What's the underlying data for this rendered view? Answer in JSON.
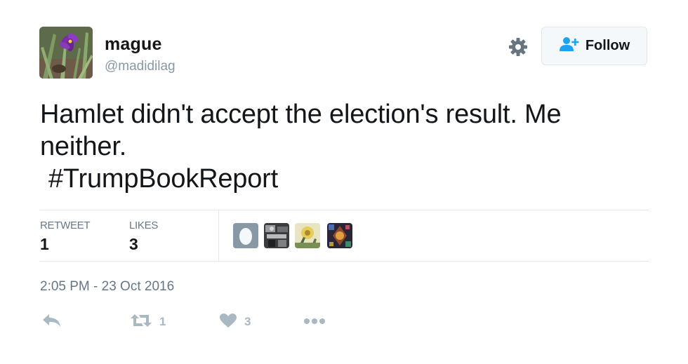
{
  "user": {
    "display_name": "mague",
    "handle": "@madidilag",
    "avatar_icon": "purple-iris-flower-photo"
  },
  "header": {
    "settings_icon": "gear-icon",
    "follow_label": "Follow",
    "follow_icon": "add-user-icon"
  },
  "tweet": {
    "line1": "Hamlet didn't accept the election's result. Me",
    "line2": "neither.",
    "hashtag": "#TrumpBookReport"
  },
  "stats": {
    "retweets_label": "RETWEET",
    "retweets_value": "1",
    "likes_label": "LIKES",
    "likes_value": "3"
  },
  "likers": [
    {
      "icon": "default-egg-avatar"
    },
    {
      "icon": "photo-avatar-dark-room"
    },
    {
      "icon": "photo-avatar-yellow-flower"
    },
    {
      "icon": "photo-avatar-colorful-art"
    }
  ],
  "timestamp": "2:05 PM - 23 Oct 2016",
  "actions": {
    "reply_icon": "reply-icon",
    "retweet_icon": "retweet-icon",
    "retweet_count": "1",
    "like_icon": "heart-icon",
    "like_count": "3",
    "more_icon": "more-dots-icon"
  },
  "colors": {
    "text": "#14171a",
    "secondary": "#657786",
    "muted_icon": "#aab8c2",
    "follow_icon_blue": "#1da1f2",
    "border": "#e1e8ed"
  }
}
